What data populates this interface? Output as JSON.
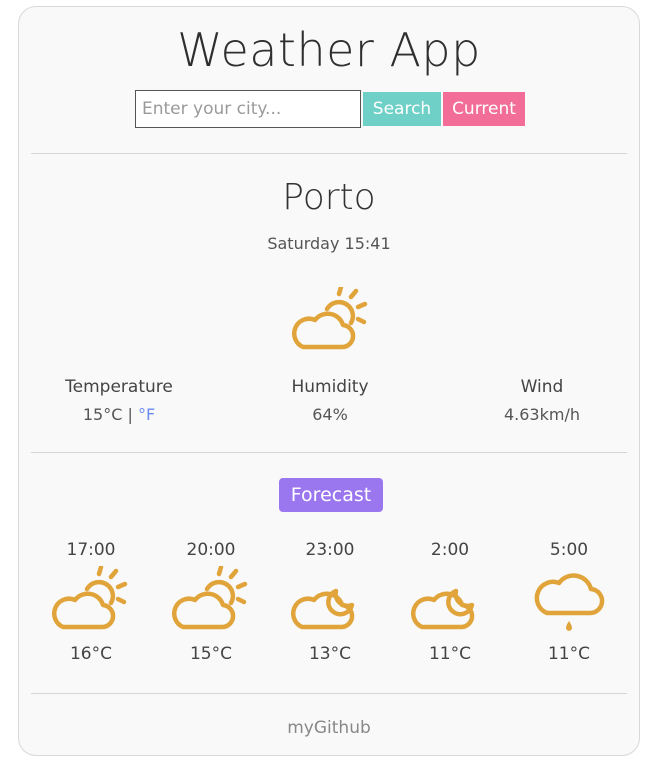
{
  "app": {
    "title": "Weather App"
  },
  "search": {
    "placeholder": "Enter your city...",
    "value": "",
    "search_label": "Search",
    "current_label": "Current"
  },
  "current": {
    "city": "Porto",
    "datetime": "Saturday 15:41",
    "icon": "sun-behind-cloud-icon",
    "temperature_label": "Temperature",
    "temperature_value": "15°C",
    "unit_separator": " | ",
    "fahrenheit_link": "°F",
    "humidity_label": "Humidity",
    "humidity_value": "64%",
    "wind_label": "Wind",
    "wind_value": "4.63km/h"
  },
  "forecast": {
    "title": "Forecast",
    "items": [
      {
        "time": "17:00",
        "icon": "sun-behind-cloud-icon",
        "temp": "16°C"
      },
      {
        "time": "20:00",
        "icon": "sun-behind-cloud-icon",
        "temp": "15°C"
      },
      {
        "time": "23:00",
        "icon": "moon-behind-cloud-icon",
        "temp": "13°C"
      },
      {
        "time": "2:00",
        "icon": "moon-behind-cloud-icon",
        "temp": "11°C"
      },
      {
        "time": "5:00",
        "icon": "drizzle-cloud-icon",
        "temp": "11°C"
      }
    ]
  },
  "footer": {
    "link_label": "myGithub"
  },
  "colors": {
    "icon": "#e0a43a",
    "search_button": "#6fd0c8",
    "current_button": "#f26d98",
    "forecast_badge": "#9a76ef",
    "link": "#6b8cf0"
  }
}
